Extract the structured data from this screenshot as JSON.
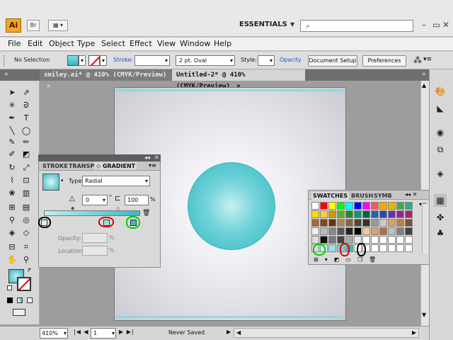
{
  "app": {
    "logo": "Ai",
    "bridge": "Br",
    "workspace": "ESSENTIALS"
  },
  "menu": [
    "File",
    "Edit",
    "Object",
    "Type",
    "Select",
    "Effect",
    "View",
    "Window",
    "Help"
  ],
  "control": {
    "selection": "No Selection",
    "stroke_label": "Stroke:",
    "brush": "2 pt. Oval",
    "style_label": "Style:",
    "opacity_label": "Opacity",
    "doc_setup": "Document Setup",
    "preferences": "Preferences"
  },
  "tabs": [
    {
      "label": "smiley.ai* @ 410% (CMYK/Preview)",
      "close": "×"
    },
    {
      "label": "Untitled-2* @ 410% (CMYK/Preview)",
      "close": "×"
    }
  ],
  "gradient_panel": {
    "tabs": [
      "STROKE",
      "TRANSP",
      "◇ GRADIENT"
    ],
    "type_label": "Type:",
    "type_value": "Radial",
    "angle": "0",
    "angle_unit": "°",
    "aspect": "100",
    "aspect_unit": "%",
    "opacity_label": "Opacity:",
    "location_label": "Location:",
    "pct": "%"
  },
  "swatches_panel": {
    "tabs": [
      "SWATCHES",
      "BRUSH",
      "SYMB"
    ]
  },
  "status": {
    "zoom": "410%",
    "page": "1",
    "saved": "Never Saved"
  },
  "colors": {
    "accent": "#36bbc5",
    "annot_black": "#000000",
    "annot_red": "#e00000",
    "annot_green": "#00cc00"
  },
  "icons": {
    "search": "search-icon",
    "minimize": "minimize-icon",
    "restore": "restore-icon",
    "close": "close-icon"
  }
}
